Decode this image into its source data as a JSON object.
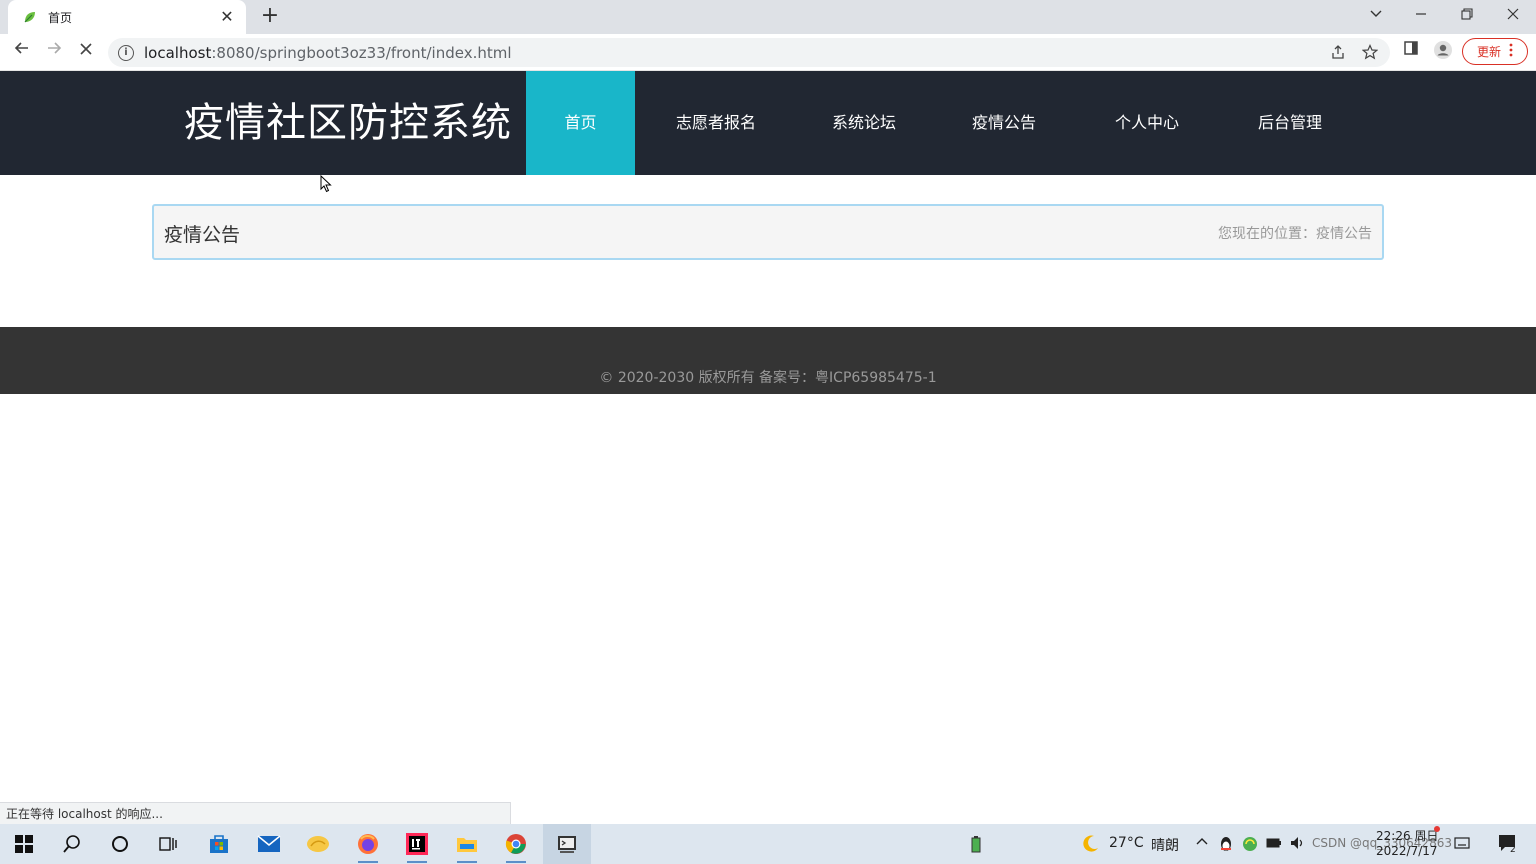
{
  "browser": {
    "tab_title": "首页",
    "tab_close": "✕",
    "new_tab": "+",
    "url_host": "localhost",
    "url_rest": ":8080/springboot3oz33/front/index.html",
    "update_label": "更新",
    "status_text": "正在等待 localhost 的响应..."
  },
  "site": {
    "title": "疫情社区防控系统",
    "nav": [
      {
        "label": "首页",
        "active": true
      },
      {
        "label": "志愿者报名",
        "active": false
      },
      {
        "label": "系统论坛",
        "active": false
      },
      {
        "label": "疫情公告",
        "active": false
      },
      {
        "label": "个人中心",
        "active": false
      },
      {
        "label": "后台管理",
        "active": false
      }
    ],
    "accent_color": "#19b6c9",
    "header_color": "#212732"
  },
  "breadcrumb": {
    "title": "疫情公告",
    "location": "您现在的位置：疫情公告"
  },
  "footer": {
    "copyright": "© 2020-2030 版权所有 备案号：粤ICP65985475-1"
  },
  "taskbar": {
    "weather_temp": "27°C",
    "weather_desc": "晴朗",
    "time": "22:26 周日",
    "date": "2022/7/17",
    "watermark": "CSDN @qq_330642863",
    "notification_count": "2"
  }
}
